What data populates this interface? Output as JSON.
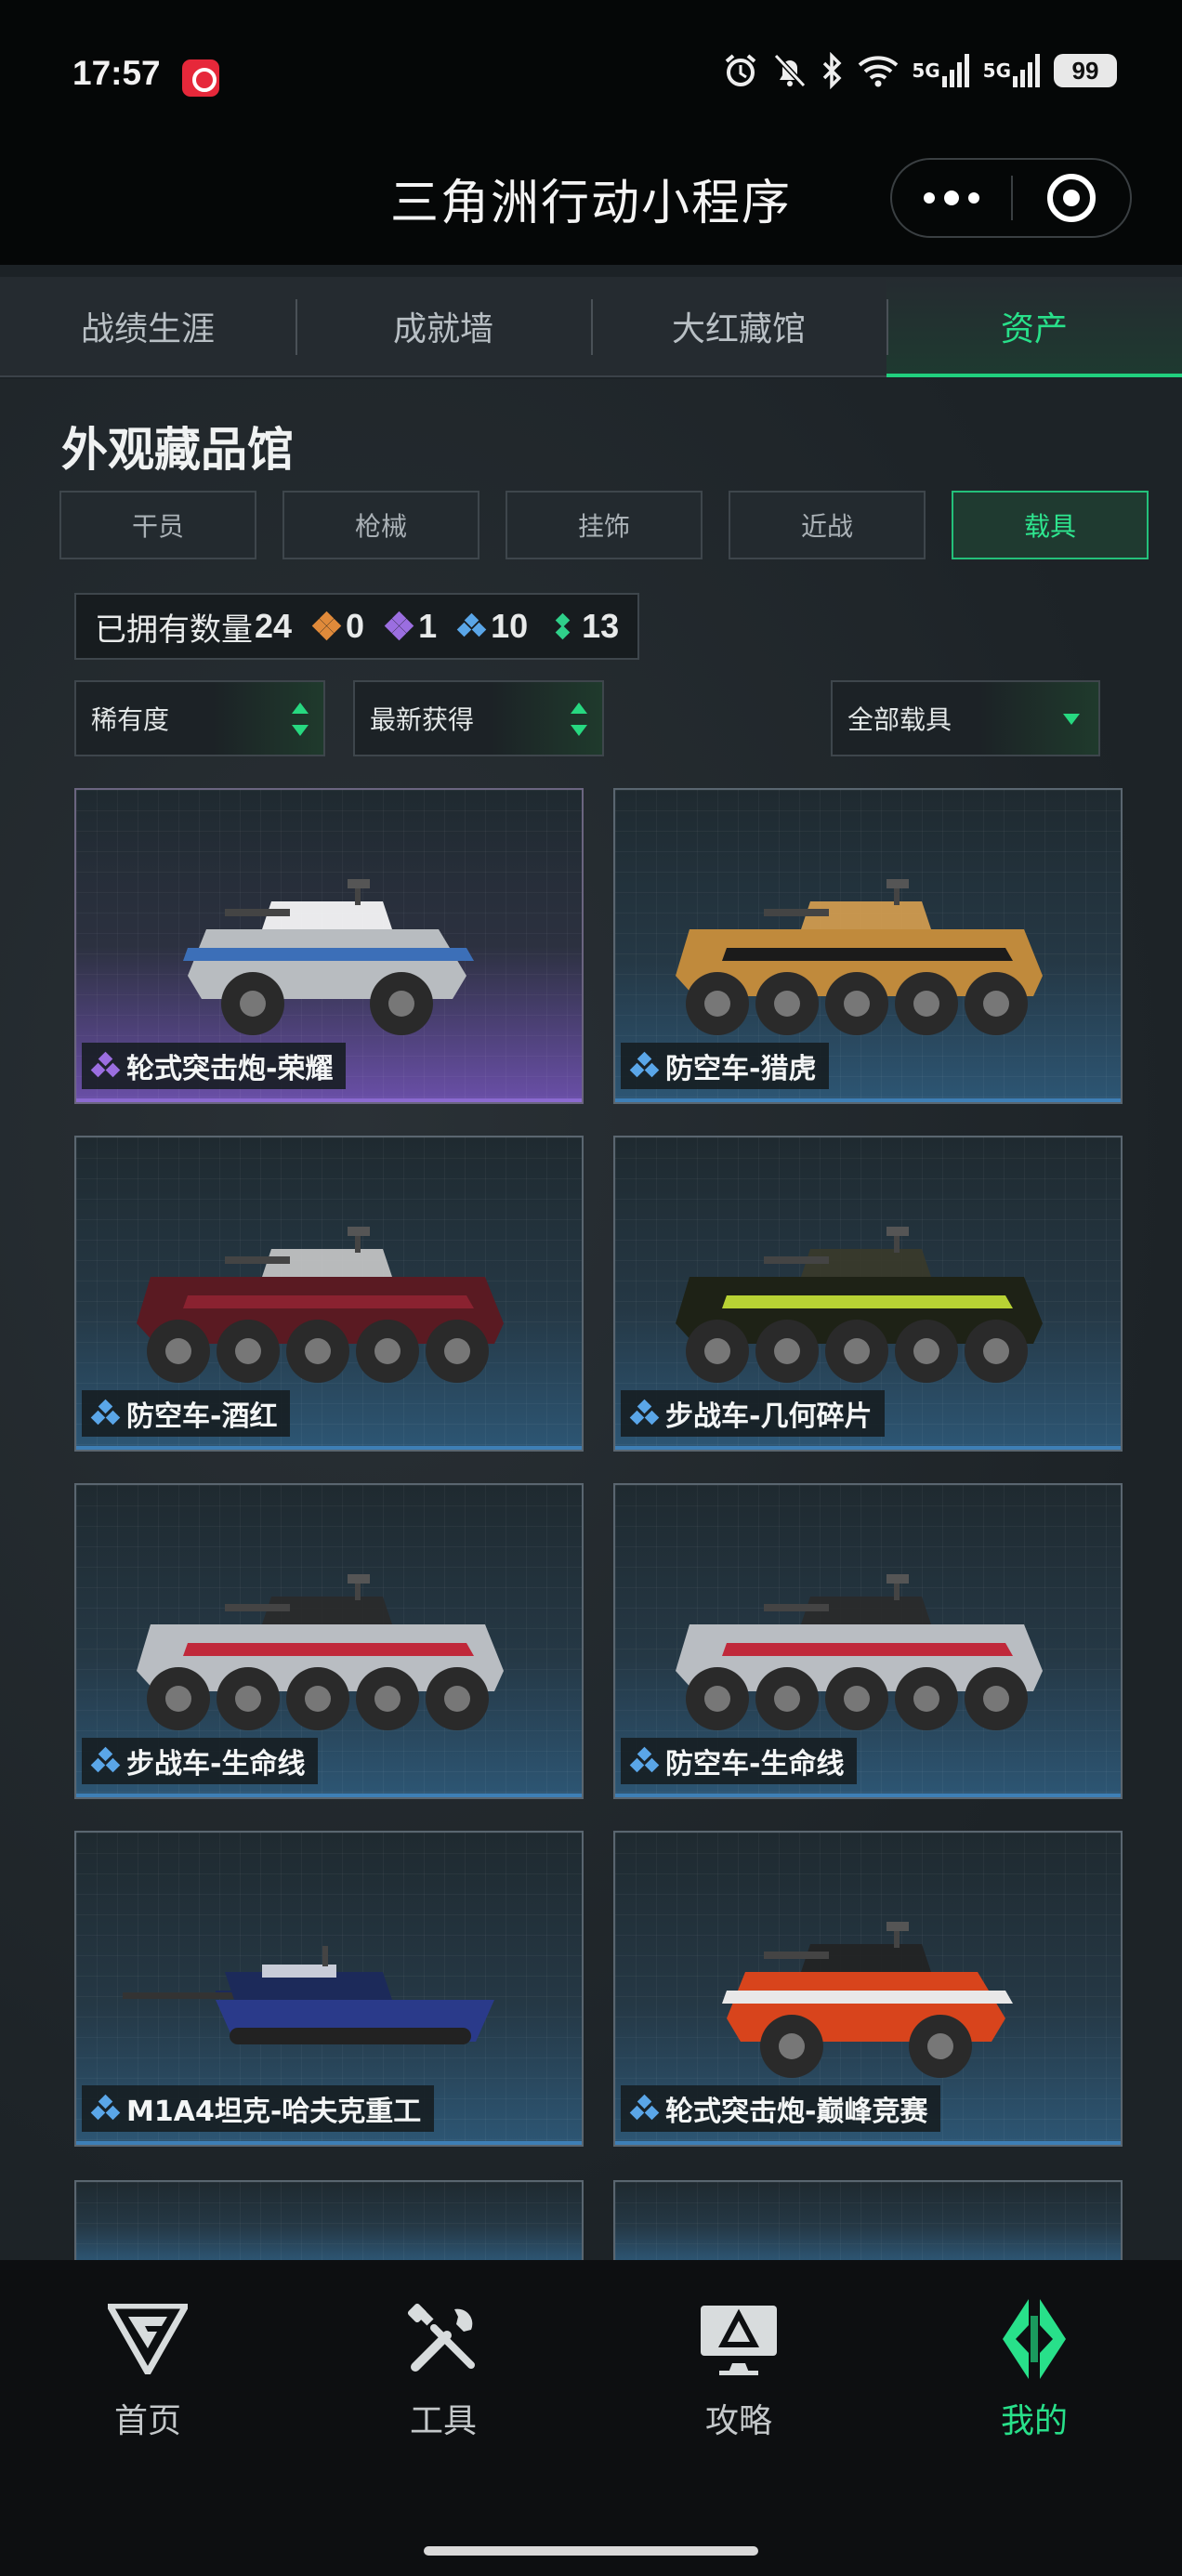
{
  "status": {
    "time": "17:57",
    "signal1": "5G",
    "signal2": "5G",
    "battery": "99"
  },
  "miniprogram": {
    "title": "三角洲行动小程序"
  },
  "tabs": [
    {
      "label": "战绩生涯"
    },
    {
      "label": "成就墙"
    },
    {
      "label": "大红藏馆"
    },
    {
      "label": "资产",
      "active": true
    }
  ],
  "section": {
    "title": "外观藏品馆"
  },
  "filters": [
    {
      "label": "干员"
    },
    {
      "label": "枪械"
    },
    {
      "label": "挂饰"
    },
    {
      "label": "近战"
    },
    {
      "label": "载具",
      "active": true
    }
  ],
  "owned": {
    "label": "已拥有数量",
    "total": "24",
    "counts": [
      {
        "color": "#e08a3a",
        "value": "0"
      },
      {
        "color": "#9b6ee0",
        "value": "1"
      },
      {
        "color": "#5aa6e8",
        "value": "10"
      },
      {
        "color": "#2fd08a",
        "value": "13"
      }
    ]
  },
  "dropdowns": {
    "rarity": "稀有度",
    "sort": "最新获得",
    "type": "全部载具"
  },
  "vehicles": [
    {
      "name": "轮式突击炮-荣耀",
      "rarity": "purple",
      "icon": "wheeled-assault-gun-icon"
    },
    {
      "name": "防空车-猎虎",
      "rarity": "blue",
      "icon": "anti-air-vehicle-icon"
    },
    {
      "name": "防空车-酒红",
      "rarity": "blue",
      "icon": "anti-air-vehicle-icon"
    },
    {
      "name": "步战车-几何碎片",
      "rarity": "blue",
      "icon": "ifv-icon"
    },
    {
      "name": "步战车-生命线",
      "rarity": "blue",
      "icon": "ifv-icon"
    },
    {
      "name": "防空车-生命线",
      "rarity": "blue",
      "icon": "anti-air-vehicle-icon"
    },
    {
      "name": "M1A4坦克-哈夫克重工",
      "rarity": "blue",
      "icon": "tank-icon"
    },
    {
      "name": "轮式突击炮-巅峰竞赛",
      "rarity": "blue",
      "icon": "wheeled-assault-gun-icon"
    }
  ],
  "bottom_nav": [
    {
      "label": "首页",
      "icon": "home-logo-icon"
    },
    {
      "label": "工具",
      "icon": "tools-icon"
    },
    {
      "label": "攻略",
      "icon": "guide-monitor-icon"
    },
    {
      "label": "我的",
      "icon": "profile-logo-icon",
      "active": true
    }
  ],
  "colors": {
    "accent": "#28e08a",
    "blue_rarity": "#5aa6e8",
    "purple_rarity": "#9b6ee0"
  }
}
